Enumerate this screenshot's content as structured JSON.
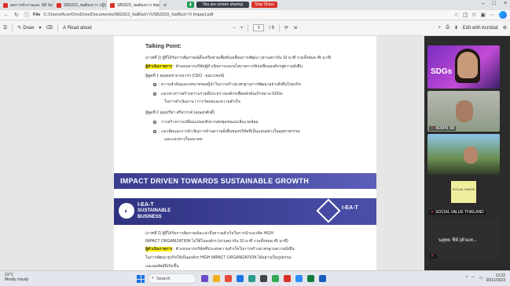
{
  "tabs": [
    {
      "label": "ผลการทำงานและ SB Session 25..."
    },
    {
      "label": "SB2023_ขอต้องการ ปฏิบัติ..."
    },
    {
      "label": "SB2023_ขอต้องการ Impact..."
    }
  ],
  "sharing": {
    "message": "You are screen sharing",
    "stop_label": "Stop Share"
  },
  "address": {
    "scheme": "File",
    "path": "C:/Users/Acer/OneDrive/Documents/SB2023_ขอต้องการ/SB2023_ขอต้องการ Impact.pdf"
  },
  "pdf_toolbar": {
    "draw_label": "Draw",
    "read_aloud_label": "Read aloud",
    "page_current": "9",
    "page_total": "/ 9",
    "acrobat_label": "Edit with Acrobat"
  },
  "document": {
    "heading": "Talking Point:",
    "lines": [
      "(ภาพที่ 1) ผู้ที่ได้รับการสัมภาษณ์ตั้งเครือข่ายเพื่อขับเคลื่อนการพัฒนา (ผ่านสถาบัน 10 นาที รวมทั้งหมด 45 นาที)",
      "ผู้ดำเนินรายการ",
      " : ตัวแทนจากบริษัทผู้ดำเนินการและนโยบายการขับเคลื่อนองค์กรสู่ความยั่งยืน",
      "ผู้พูดที่ 1 คุณสมชาย ธนากร (CEO : คุณวรพงษ์)",
      "ความสำคัญและบทบาทของผู้นำในการสร้างมาตรฐานการพัฒนาอย่างยั่งยืนในธุรกิจ",
      "แนวทางการสร้างความร่วมมือระหว่างองค์กรเพื่อผลักดันเป้าหมาย SDGs",
      "ในการดำเนินงาน / การวัดผลและความสำเร็จ",
      "ผู้พูดที่ 2 คุณปรีชา ศรีสวรรค์ (คุณสุรศักดิ์)",
      "การสร้างการเปลี่ยนแปลงเชิงบวกต่อชุมชนและสิ่งแวดล้อม",
      "แนวคิดและการดำเนินการด้านความยั่งยืนของบริษัทที่เป็นแบบอย่างในอุตสาหกรรม",
      "และแนวทางในอนาคต",
      "(ภาพที่ 2) ผู้ที่ได้รับการสัมภาษณ์จะเล่าถึงความสำเร็จในการนำแนวคิด HIGH",
      "IMPACT ORGANIZATION ไปใช้ในองค์กร (ผ่านสถาบัน 10 นาที รวมทั้งหมด 45 นาที)",
      "ผู้ดำเนินรายการ",
      " : ตัวแทนจากบริษัทที่ประสบความสำเร็จในการสร้างมาตรฐานความยั่งยืน",
      "ในการพัฒนาธุรกิจให้เป็นองค์กร HIGH IMPACT ORGANIZATION ได้อย่างเป็นรูปธรรม",
      "และผลลัพธ์ที่เกิดขึ้น"
    ],
    "banner_impact": "IMPACT DRIVEN TOWARDS SUSTAINABLE GROWTH",
    "banner2_line1": "I-EA-T",
    "banner2_line2": "SUSTAINABLE",
    "banner2_line3": "BUSINESS",
    "banner2_brand": "I-EA-T"
  },
  "meeting": {
    "tile1_overlay": "SDGs",
    "tile2_name": "ADMIN SB",
    "tile3_name": "",
    "tile4_card": "SOCIAL IMAGE",
    "tile4_name": "SOCIAL VALUE THAILAND",
    "tile5_name": "นลุทธ ชีห์ (ตัวแท..."
  },
  "taskbar": {
    "weather_temp": "31°C",
    "weather_desc": "Mostly cloudy",
    "search_placeholder": "Search",
    "time": "13:22",
    "date": "30/11/2023"
  },
  "colors": {
    "highlight": "#fff200",
    "banner": "#3a3d8f",
    "stop_share": "#d93025",
    "sharing_green": "#1f9d55"
  }
}
